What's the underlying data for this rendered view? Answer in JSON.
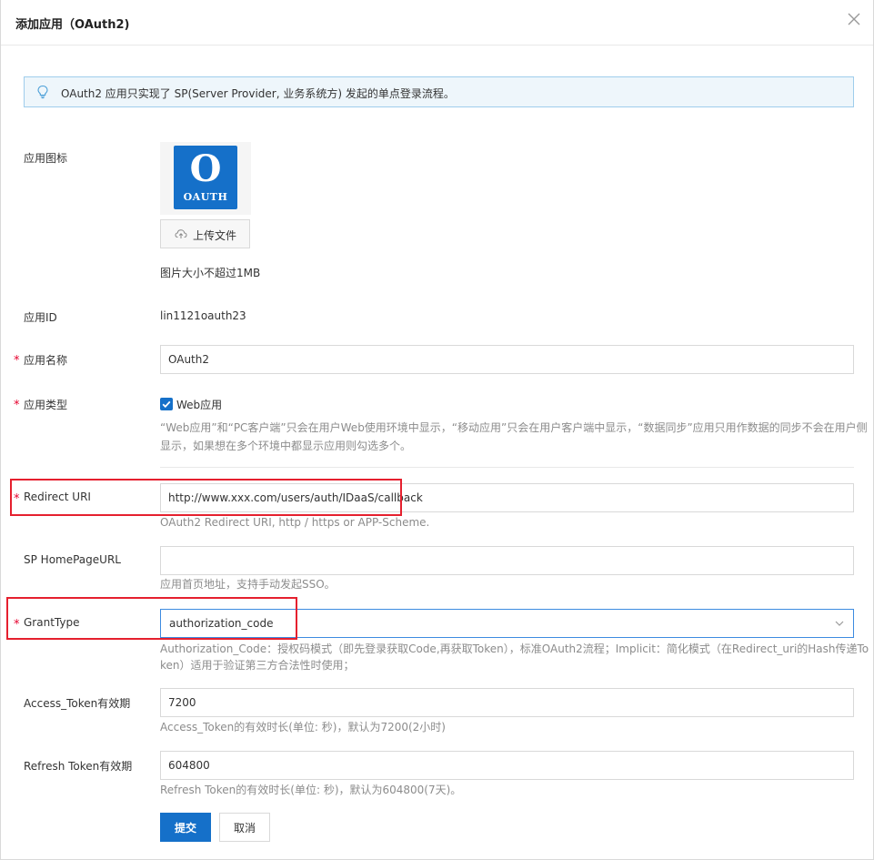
{
  "dialog": {
    "title": "添加应用（OAuth2)"
  },
  "notice": {
    "text": "OAuth2 应用只实现了 SP(Server Provider, 业务系统方) 发起的单点登录流程。"
  },
  "form": {
    "icon": {
      "label": "应用图标",
      "logo_big": "O",
      "logo_small": "OAUTH",
      "upload_label": "上传文件",
      "help": "图片大小不超过1MB"
    },
    "app_id": {
      "label": "应用ID",
      "value": "lin1121oauth23"
    },
    "app_name": {
      "label": "应用名称",
      "value": "OAuth2"
    },
    "app_type": {
      "label": "应用类型",
      "option_label": "Web应用",
      "checked": true,
      "help_line1": "“Web应用”和“PC客户端”只会在用户Web使用环境中显示，“移动应用”只会在用户客户端中显示，“数据同步”应用只用作数据的同步不会在用户侧",
      "help_line2": "显示，如果想在多个环境中都显示应用则勾选多个。"
    },
    "redirect_uri": {
      "label": "Redirect URI",
      "value": "http://www.xxx.com/users/auth/IDaaS/callback",
      "help": "OAuth2 Redirect URI, http / https or APP-Scheme."
    },
    "sp_homepage": {
      "label": "SP HomePageURL",
      "value": "",
      "help": "应用首页地址，支持手动发起SSO。"
    },
    "grant_type": {
      "label": "GrantType",
      "value": "authorization_code",
      "help_line1": "Authorization_Code：授权码模式（即先登录获取Code,再获取Token），标准OAuth2流程；Implicit：简化模式（在Redirect_uri的Hash传递To",
      "help_line2": "ken）适用于验证第三方合法性时使用；"
    },
    "access_token": {
      "label": "Access_Token有效期",
      "value": "7200",
      "help": "Access_Token的有效时长(单位: 秒)，默认为7200(2小时)"
    },
    "refresh_token": {
      "label": "Refresh Token有效期",
      "value": "604800",
      "help": "Refresh Token的有效时长(单位: 秒)，默认为604800(7天)。"
    },
    "required_mark": "*"
  },
  "actions": {
    "submit_label": "提交",
    "cancel_label": "取消"
  },
  "colors": {
    "primary": "#1570c9",
    "required": "#e5002d",
    "highlight_box": "#e5202e",
    "notice_bg": "#eef6fb",
    "notice_border": "#9fcdec"
  }
}
